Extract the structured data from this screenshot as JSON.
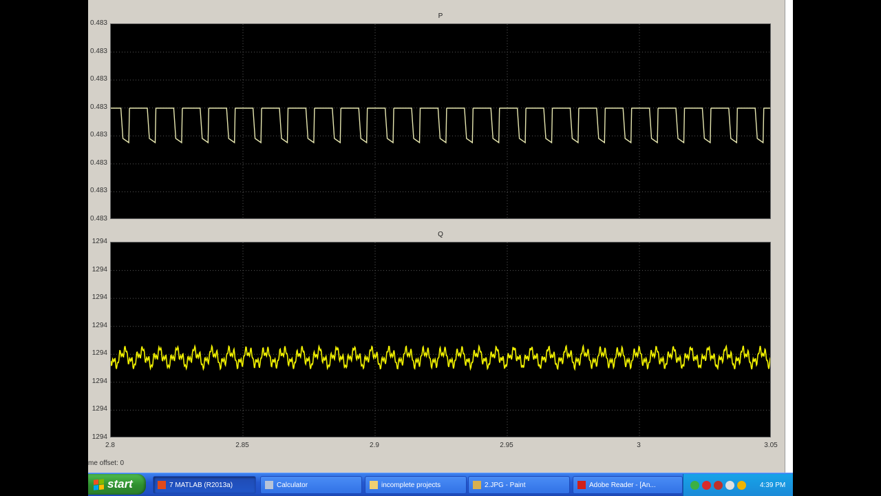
{
  "scope": {
    "plots": [
      {
        "title": "P",
        "yticks": [
          "0.483",
          "0.483",
          "0.483",
          "0.483",
          "0.483",
          "0.483",
          "0.483",
          "0.483"
        ],
        "signal_color": "#e8e8b0"
      },
      {
        "title": "Q",
        "yticks": [
          "1294",
          "1294",
          "1294",
          "1294",
          "1294",
          "1294",
          "1294",
          "1294"
        ],
        "signal_color": "#f2f200"
      }
    ],
    "xticks": [
      "2.8",
      "2.85",
      "2.9",
      "2.95",
      "3",
      "3.05"
    ],
    "status_text": "me offset:  0"
  },
  "chart_data": [
    {
      "type": "line",
      "title": "P",
      "xlim": [
        2.8,
        3.05
      ],
      "grid": true,
      "series": [
        {
          "shape": "sawtooth-square",
          "period": 0.01,
          "high_level": 0.4833,
          "low_level": 0.4831,
          "color": "#e8e8b0"
        }
      ]
    },
    {
      "type": "line",
      "title": "Q",
      "xlim": [
        2.8,
        3.05
      ],
      "grid": true,
      "series": [
        {
          "shape": "noisy-oscillation",
          "period": 0.0067,
          "mean_level": 1294,
          "color": "#f2f200"
        }
      ]
    }
  ],
  "taskbar": {
    "start_label": "start",
    "items": [
      {
        "label": "7 MATLAB (R2013a)",
        "icon": "matlab-icon",
        "color": "#e04a1a",
        "active": true
      },
      {
        "label": "Calculator",
        "icon": "calculator-icon",
        "color": "#b8c4d8",
        "active": false
      },
      {
        "label": "incomplete projects",
        "icon": "folder-icon",
        "color": "#f0d070",
        "active": false
      },
      {
        "label": "2.JPG - Paint",
        "icon": "paint-icon",
        "color": "#d8b050",
        "active": false
      },
      {
        "label": "Adobe Reader - [An...",
        "icon": "adobe-icon",
        "color": "#d0201a",
        "active": false
      }
    ],
    "clock": "4:39 PM"
  }
}
